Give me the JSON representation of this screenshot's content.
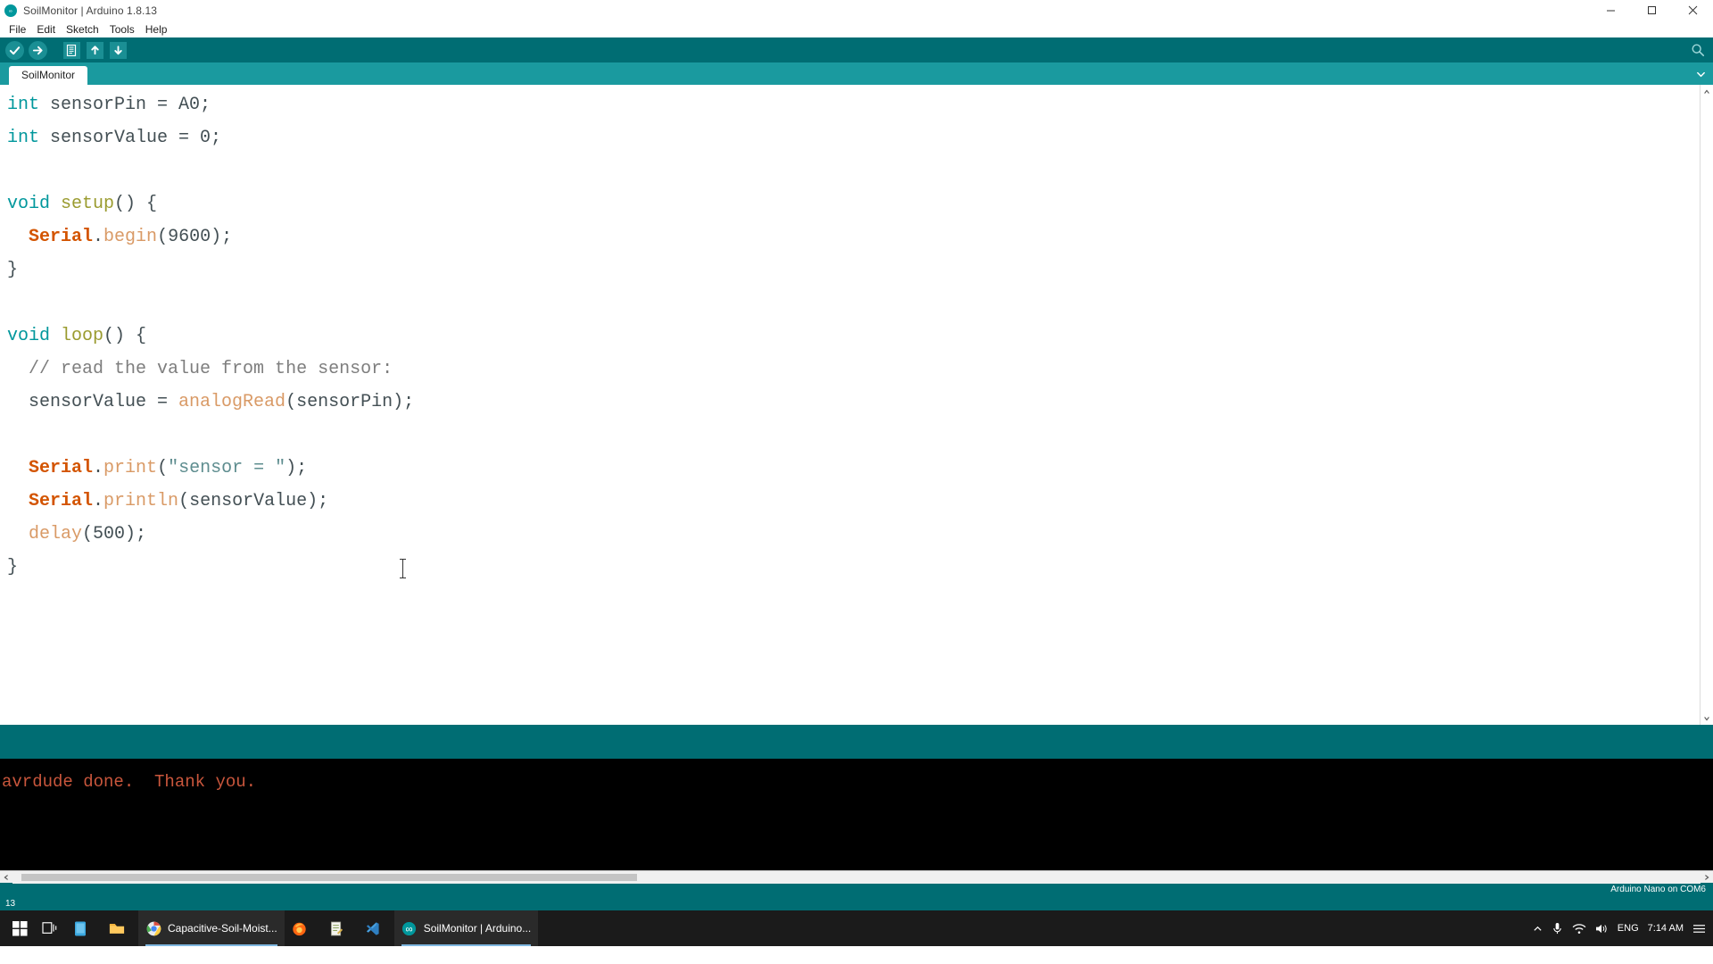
{
  "window": {
    "title": "SoilMonitor | Arduino 1.8.13",
    "logo_icon": "arduino-infinity-icon",
    "minimize_icon": "minimize-icon",
    "maximize_icon": "maximize-icon",
    "close_icon": "close-icon"
  },
  "menubar": {
    "items": [
      {
        "label": "File"
      },
      {
        "label": "Edit"
      },
      {
        "label": "Sketch"
      },
      {
        "label": "Tools"
      },
      {
        "label": "Help"
      }
    ]
  },
  "toolbar": {
    "buttons": [
      {
        "name": "verify",
        "icon": "check-icon",
        "tooltip": "Verify"
      },
      {
        "name": "upload",
        "icon": "arrow-right-icon",
        "tooltip": "Upload"
      },
      {
        "name": "new",
        "icon": "new-file-icon",
        "tooltip": "New"
      },
      {
        "name": "open",
        "icon": "arrow-up-icon",
        "tooltip": "Open"
      },
      {
        "name": "save",
        "icon": "arrow-down-icon",
        "tooltip": "Save"
      }
    ],
    "serial_monitor": {
      "name": "serial-monitor",
      "icon": "magnifier-icon",
      "tooltip": "Serial Monitor"
    }
  },
  "tabs": {
    "active": "SoilMonitor",
    "items": [
      {
        "label": "SoilMonitor"
      }
    ],
    "menu_icon": "chevron-down-icon"
  },
  "editor": {
    "lines": [
      {
        "n": 1,
        "tokens": [
          {
            "t": "int",
            "c": "k"
          },
          {
            "t": " sensorPin = A0;",
            "c": "pun"
          }
        ]
      },
      {
        "n": 2,
        "tokens": [
          {
            "t": "int",
            "c": "k"
          },
          {
            "t": " sensorValue = 0;",
            "c": "pun"
          }
        ]
      },
      {
        "n": 3,
        "tokens": []
      },
      {
        "n": 4,
        "tokens": [
          {
            "t": "void",
            "c": "k"
          },
          {
            "t": " ",
            "c": "pun"
          },
          {
            "t": "setup",
            "c": "fn"
          },
          {
            "t": "() {",
            "c": "pun"
          }
        ]
      },
      {
        "n": 5,
        "tokens": [
          {
            "t": "  ",
            "c": "pun"
          },
          {
            "t": "Serial",
            "c": "obj"
          },
          {
            "t": ".",
            "c": "pun"
          },
          {
            "t": "begin",
            "c": "mth"
          },
          {
            "t": "(9600);",
            "c": "pun"
          }
        ]
      },
      {
        "n": 6,
        "tokens": [
          {
            "t": "}",
            "c": "pun"
          }
        ]
      },
      {
        "n": 7,
        "tokens": []
      },
      {
        "n": 8,
        "tokens": [
          {
            "t": "void",
            "c": "k"
          },
          {
            "t": " ",
            "c": "pun"
          },
          {
            "t": "loop",
            "c": "fn"
          },
          {
            "t": "() {",
            "c": "pun"
          }
        ]
      },
      {
        "n": 9,
        "tokens": [
          {
            "t": "  ",
            "c": "pun"
          },
          {
            "t": "// read the value from the sensor:",
            "c": "cmt"
          }
        ]
      },
      {
        "n": 10,
        "tokens": [
          {
            "t": "  sensorValue = ",
            "c": "pun"
          },
          {
            "t": "analogRead",
            "c": "mth"
          },
          {
            "t": "(sensorPin);",
            "c": "pun"
          }
        ]
      },
      {
        "n": 11,
        "tokens": []
      },
      {
        "n": 12,
        "tokens": [
          {
            "t": "  ",
            "c": "pun"
          },
          {
            "t": "Serial",
            "c": "obj"
          },
          {
            "t": ".",
            "c": "pun"
          },
          {
            "t": "print",
            "c": "mth"
          },
          {
            "t": "(",
            "c": "pun"
          },
          {
            "t": "\"sensor = \"",
            "c": "str"
          },
          {
            "t": ");",
            "c": "pun"
          }
        ]
      },
      {
        "n": 13,
        "tokens": [
          {
            "t": "  ",
            "c": "pun"
          },
          {
            "t": "Serial",
            "c": "obj"
          },
          {
            "t": ".",
            "c": "pun"
          },
          {
            "t": "println",
            "c": "mth"
          },
          {
            "t": "(sensorValue);",
            "c": "pun"
          }
        ]
      },
      {
        "n": 14,
        "tokens": [
          {
            "t": "  ",
            "c": "pun"
          },
          {
            "t": "delay",
            "c": "mth"
          },
          {
            "t": "(500);",
            "c": "pun"
          }
        ]
      },
      {
        "n": 15,
        "tokens": [
          {
            "t": "}",
            "c": "pun"
          }
        ]
      }
    ],
    "scroll_up_icon": "chevron-up-icon",
    "scroll_down_icon": "chevron-down-icon"
  },
  "console": {
    "text": "avrdude done.  Thank you.",
    "scroll_left_icon": "chevron-left-icon",
    "scroll_right_icon": "chevron-right-icon"
  },
  "statusbar": {
    "line_number": "13",
    "board": "Arduino Nano on COM6"
  },
  "taskbar": {
    "start_icon": "windows-start-icon",
    "taskview_icon": "task-view-icon",
    "items": [
      {
        "name": "store",
        "icon": "store-icon",
        "label": ""
      },
      {
        "name": "file-explorer",
        "icon": "folder-icon",
        "label": ""
      },
      {
        "name": "chrome-window",
        "icon": "chrome-icon",
        "label": "Capacitive-Soil-Moist..."
      },
      {
        "name": "firefox",
        "icon": "firefox-icon",
        "label": ""
      },
      {
        "name": "notepad",
        "icon": "notepad-icon",
        "label": ""
      },
      {
        "name": "vscode",
        "icon": "vscode-icon",
        "label": ""
      },
      {
        "name": "arduino-window",
        "icon": "arduino-icon",
        "label": "SoilMonitor | Arduino..."
      }
    ],
    "tray": {
      "show_hidden_icon": "chevron-up-icon",
      "mic_icon": "microphone-icon",
      "network_icon": "wifi-icon",
      "volume_icon": "speaker-icon",
      "language": "ENG",
      "time": "7:14 AM",
      "notifications_icon": "notification-icon"
    }
  },
  "colors": {
    "brand_teal": "#006D73",
    "tab_teal": "#1A9A9F",
    "keyword": "#00979C",
    "object": "#D35400",
    "method": "#D99A66",
    "string": "#5E8D8F",
    "comment": "#7E7E7E",
    "console_text": "#C9563C"
  }
}
